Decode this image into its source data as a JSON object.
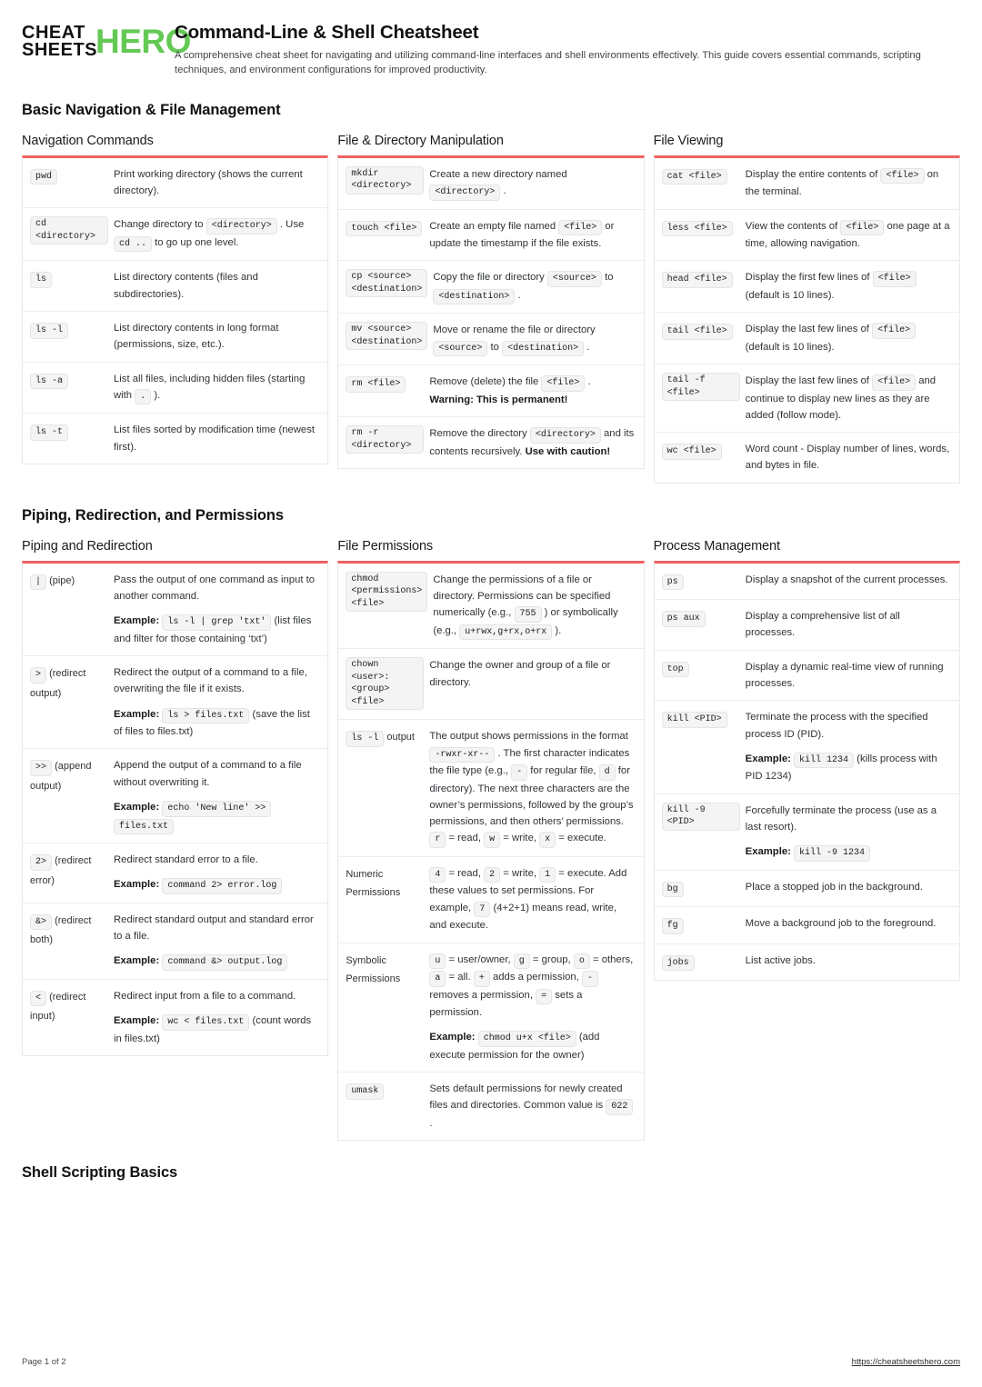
{
  "brand": {
    "line1": "CHEAT",
    "line2": "SHEETS",
    "hero": "HERO",
    "hero_color": "#63c954"
  },
  "header": {
    "title": "Command-Line & Shell Cheatsheet",
    "description": "A comprehensive cheat sheet for navigating and utilizing command-line interfaces and shell environments effectively. This guide covers essential commands, scripting techniques, and environment configurations for improved productivity."
  },
  "accent_color": "#f06060",
  "sections": [
    {
      "title": "Basic Navigation & File Management",
      "cards": [
        {
          "title": "Navigation Commands",
          "rows": [
            {
              "term": [
                "pwd"
              ],
              "desc_html": "Print working directory (shows the current directory)."
            },
            {
              "term": [
                "cd <directory>"
              ],
              "desc_html": "Change directory to <code>&lt;directory&gt;</code> . Use <code>cd ..</code> to go up one level."
            },
            {
              "term": [
                "ls"
              ],
              "desc_html": "List directory contents (files and subdirectories)."
            },
            {
              "term": [
                "ls -l"
              ],
              "desc_html": "List directory contents in long format (permissions, size, etc.)."
            },
            {
              "term": [
                "ls -a"
              ],
              "desc_html": "List all files, including hidden files (starting with <code>.</code> )."
            },
            {
              "term": [
                "ls -t"
              ],
              "desc_html": "List files sorted by modification time (newest first)."
            }
          ]
        },
        {
          "title": "File & Directory Manipulation",
          "rows": [
            {
              "term": [
                "mkdir <directory>"
              ],
              "desc_html": "Create a new directory named <code>&lt;directory&gt;</code> ."
            },
            {
              "term": [
                "touch <file>"
              ],
              "desc_html": "Create an empty file named <code>&lt;file&gt;</code> or update the timestamp if the file exists."
            },
            {
              "term": [
                "cp <source> <destination>"
              ],
              "desc_html": "Copy the file or directory <code>&lt;source&gt;</code> to <code>&lt;destination&gt;</code> ."
            },
            {
              "term": [
                "mv <source> <destination>"
              ],
              "desc_html": "Move or rename the file or directory <code>&lt;source&gt;</code> to <code>&lt;destination&gt;</code> ."
            },
            {
              "term": [
                "rm <file>"
              ],
              "desc_html": "Remove (delete) the file <code>&lt;file&gt;</code> . <span class=\"warn\">Warning: This is permanent!</span>"
            },
            {
              "term": [
                "rm -r <directory>"
              ],
              "desc_html": "Remove the directory <code>&lt;directory&gt;</code> and its contents recursively. <span class=\"warn\">Use with caution!</span>"
            }
          ]
        },
        {
          "title": "File Viewing",
          "rows": [
            {
              "term": [
                "cat <file>"
              ],
              "desc_html": "Display the entire contents of <code>&lt;file&gt;</code> on the terminal."
            },
            {
              "term": [
                "less <file>"
              ],
              "desc_html": "View the contents of <code>&lt;file&gt;</code> one page at a time, allowing navigation."
            },
            {
              "term": [
                "head <file>"
              ],
              "desc_html": "Display the first few lines of <code>&lt;file&gt;</code> (default is 10 lines)."
            },
            {
              "term": [
                "tail <file>"
              ],
              "desc_html": "Display the last few lines of <code>&lt;file&gt;</code> (default is 10 lines)."
            },
            {
              "term": [
                "tail -f <file>"
              ],
              "desc_html": "Display the last few lines of <code>&lt;file&gt;</code> and continue to display new lines as they are added (follow mode)."
            },
            {
              "term": [
                "wc <file>"
              ],
              "desc_html": "Word count - Display number of lines, words, and bytes in file."
            }
          ]
        }
      ]
    },
    {
      "title": "Piping, Redirection, and Permissions",
      "cards": [
        {
          "title": "Piping and Redirection",
          "rows": [
            {
              "term_html": "<code>|</code> (pipe)",
              "desc_html": "Pass the output of one command as input to another command.<div class=\"exline\"><span class=\"ex-label\">Example:</span> <code>ls -l | grep 'txt'</code> (list files and filter for those containing &lsquo;txt&rsquo;)</div>"
            },
            {
              "term_html": "<code>&gt;</code> (redirect output)",
              "desc_html": "Redirect the output of a command to a file, overwriting the file if it exists.<div class=\"exline\"><span class=\"ex-label\">Example:</span> <code>ls &gt; files.txt</code> (save the list of files to files.txt)</div>"
            },
            {
              "term_html": "<code>&gt;&gt;</code> (append output)",
              "desc_html": "Append the output of a command to a file without overwriting it.<div class=\"exline\"><span class=\"ex-label\">Example:</span> <code>echo 'New line' &gt;&gt;</code> <code>files.txt</code></div>"
            },
            {
              "term_html": "<code>2&gt;</code> (redirect error)",
              "desc_html": "Redirect standard error to a file.<div class=\"exline\"><span class=\"ex-label\">Example:</span> <code>command 2&gt; error.log</code></div>"
            },
            {
              "term_html": "<code>&amp;&gt;</code> (redirect both)",
              "desc_html": "Redirect standard output and standard error to a file.<div class=\"exline\"><span class=\"ex-label\">Example:</span> <code>command &amp;&gt; output.log</code></div>"
            },
            {
              "term_html": "<code>&lt;</code> (redirect input)",
              "desc_html": "Redirect input from a file to a command.<div class=\"exline\"><span class=\"ex-label\">Example:</span> <code>wc &lt; files.txt</code> (count words in files.txt)</div>"
            }
          ]
        },
        {
          "title": "File Permissions",
          "rows": [
            {
              "term": [
                "chmod <permissions> <file>"
              ],
              "desc_html": "Change the permissions of a file or directory. Permissions can be specified numerically (e.g., <code>755</code> ) or symbolically (e.g., <code>u+rwx,g+rx,o+rx</code> )."
            },
            {
              "term": [
                "chown <user>:<group> <file>"
              ],
              "desc_html": "Change the owner and group of a file or directory."
            },
            {
              "term_html": "<code>ls -l</code> output",
              "desc_html": "The output shows permissions in the format <code>-rwxr-xr--</code> . The first character indicates the file type (e.g., <code>-</code> for regular file, <code>d</code> for directory). The next three characters are the owner&rsquo;s permissions, followed by the group&rsquo;s permissions, and then others&rsquo; permissions. <code>r</code> = read, <code>w</code> = write, <code>x</code> = execute."
            },
            {
              "term_html": "Numeric Permissions",
              "desc_html": "<code>4</code> = read, <code>2</code> = write, <code>1</code> = execute. Add these values to set permissions. For example, <code>7</code> (4+2+1) means read, write, and execute."
            },
            {
              "term_html": "Symbolic Permissions",
              "desc_html": "<code>u</code> = user/owner, <code>g</code> = group, <code>o</code> = others, <code>a</code> = all. <code>+</code> adds a permission, <code>-</code> removes a permission, <code>=</code> sets a permission.<div class=\"exline\"><span class=\"ex-label\">Example:</span> <code>chmod u+x &lt;file&gt;</code> (add execute permission for the owner)</div>"
            },
            {
              "term": [
                "umask"
              ],
              "desc_html": "Sets default permissions for newly created files and directories. Common value is <code>022</code> ."
            }
          ]
        },
        {
          "title": "Process Management",
          "rows": [
            {
              "term": [
                "ps"
              ],
              "desc_html": "Display a snapshot of the current processes."
            },
            {
              "term": [
                "ps aux"
              ],
              "desc_html": "Display a comprehensive list of all processes."
            },
            {
              "term": [
                "top"
              ],
              "desc_html": "Display a dynamic real-time view of running processes."
            },
            {
              "term": [
                "kill <PID>"
              ],
              "desc_html": "Terminate the process with the specified process ID (PID).<div class=\"exline\"><span class=\"ex-label\">Example:</span> <code>kill 1234</code> (kills process with PID 1234)</div>"
            },
            {
              "term": [
                "kill -9 <PID>"
              ],
              "desc_html": "Forcefully terminate the process (use as a last resort).<div class=\"exline\"><span class=\"ex-label\">Example:</span> <code>kill -9 1234</code></div>"
            },
            {
              "term": [
                "bg"
              ],
              "desc_html": "Place a stopped job in the background."
            },
            {
              "term": [
                "fg"
              ],
              "desc_html": "Move a background job to the foreground."
            },
            {
              "term": [
                "jobs"
              ],
              "desc_html": "List active jobs."
            }
          ]
        }
      ]
    },
    {
      "title": "Shell Scripting Basics",
      "cards": []
    }
  ],
  "footer": {
    "page_label": "Page 1 of 2",
    "url": "https://cheatsheetshero.com"
  }
}
